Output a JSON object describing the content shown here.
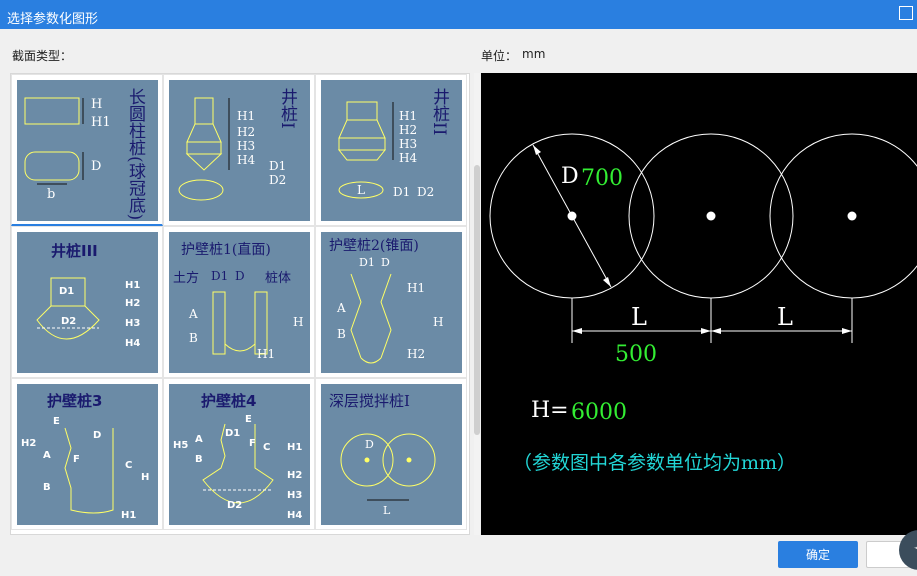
{
  "window": {
    "title": "选择参数化图形"
  },
  "labels": {
    "section_type": "截面类型：",
    "unit_label": "单位：",
    "unit_value": "mm"
  },
  "tiles": [
    {
      "title": "长圆柱桩(球冠底)",
      "params": [
        "H",
        "H1",
        "D",
        "b"
      ]
    },
    {
      "title": "井桩I",
      "params": [
        "H1",
        "H2",
        "H3",
        "H4",
        "D1",
        "D2"
      ]
    },
    {
      "title": "井桩II",
      "params": [
        "H1",
        "H2",
        "H3",
        "H4",
        "L",
        "D1",
        "D2"
      ]
    },
    {
      "title": "井桩III",
      "params": [
        "D1",
        "D2",
        "H1",
        "H2",
        "H3",
        "H4"
      ]
    },
    {
      "title": "护壁桩1(直面)",
      "params": [
        "土方",
        "D1",
        "D",
        "桩体",
        "A",
        "B",
        "H",
        "H1"
      ]
    },
    {
      "title": "护壁桩2(锥面)",
      "params": [
        "D1",
        "D",
        "H1",
        "A",
        "B",
        "H",
        "H2"
      ]
    },
    {
      "title": "护壁桩3",
      "params": [
        "E",
        "D",
        "H2",
        "A",
        "F",
        "C",
        "H",
        "B",
        "H1"
      ]
    },
    {
      "title": "护壁桩4",
      "params": [
        "E",
        "D1",
        "H5",
        "A",
        "F",
        "C",
        "B",
        "H1",
        "H2",
        "H3",
        "D2",
        "H4"
      ]
    },
    {
      "title": "深层搅拌桩I",
      "params": [
        "D",
        "L"
      ]
    }
  ],
  "preview": {
    "d_label": "D",
    "d_value": "700",
    "l_label1": "L",
    "l_label2": "L",
    "l_value": "500",
    "h_label": "H=",
    "h_value": "6000",
    "note": "（参数图中各参数单位均为mm）"
  },
  "buttons": {
    "ok": "确定"
  },
  "colors": {
    "accent": "#2a7fe0",
    "tile_bg": "#6b8ba6",
    "diagram_text": "#1a1a6e",
    "preview_green": "#33ee33",
    "preview_cyan": "#22d6d6",
    "diagram_yellow": "#ffff66"
  }
}
